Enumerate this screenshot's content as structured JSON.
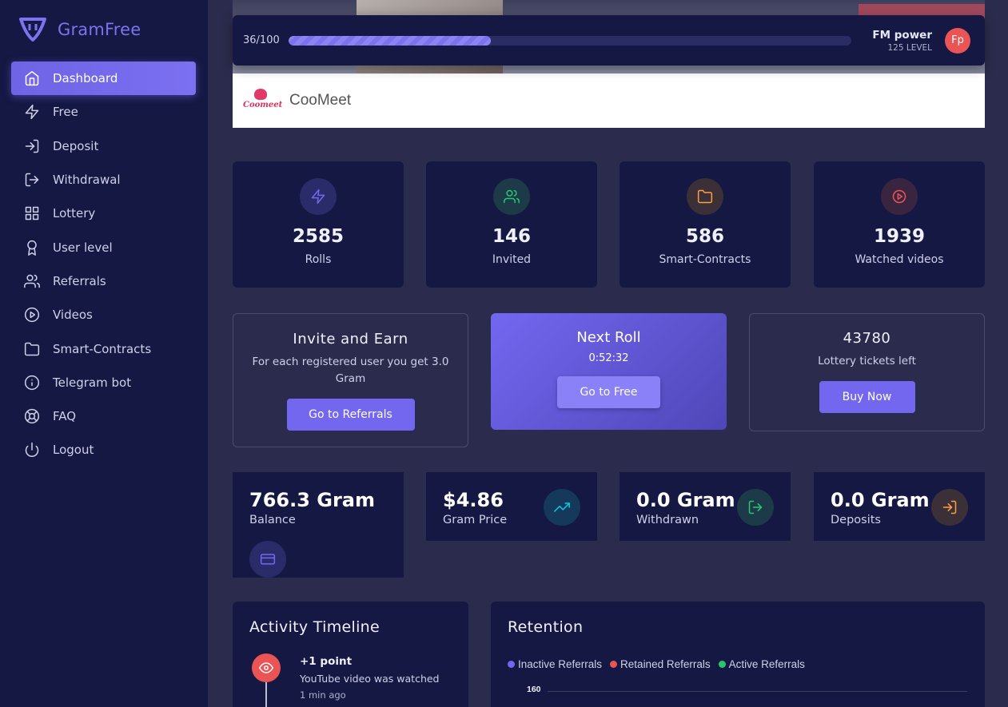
{
  "brand": {
    "name": "GramFree"
  },
  "sidebar": {
    "items": [
      {
        "label": "Dashboard",
        "icon": "home-icon",
        "active": true
      },
      {
        "label": "Free",
        "icon": "zap-icon"
      },
      {
        "label": "Deposit",
        "icon": "log-in-icon"
      },
      {
        "label": "Withdrawal",
        "icon": "log-out-icon"
      },
      {
        "label": "Lottery",
        "icon": "grid-icon"
      },
      {
        "label": "User level",
        "icon": "award-icon"
      },
      {
        "label": "Referrals",
        "icon": "users-icon"
      },
      {
        "label": "Videos",
        "icon": "play-circle-icon"
      },
      {
        "label": "Smart-Contracts",
        "icon": "folder-icon"
      },
      {
        "label": "Telegram bot",
        "icon": "info-icon"
      },
      {
        "label": "FAQ",
        "icon": "life-buoy-icon"
      },
      {
        "label": "Logout",
        "icon": "power-icon"
      }
    ]
  },
  "banner": {
    "brand": "CooMeet",
    "logo_text": "Coomeet"
  },
  "topbar": {
    "progress_label": "36/100",
    "progress_fraction": 0.36,
    "user_name": "FM power",
    "user_level": "125 LEVEL",
    "avatar_initials": "Fp"
  },
  "stats": [
    {
      "value": "2585",
      "label": "Rolls",
      "icon": "zap-icon",
      "color": "#7367f0"
    },
    {
      "value": "146",
      "label": "Invited",
      "icon": "users-icon",
      "color": "#28c76f"
    },
    {
      "value": "586",
      "label": "Smart-Contracts",
      "icon": "folder-icon",
      "color": "#ff9f43"
    },
    {
      "value": "1939",
      "label": "Watched videos",
      "icon": "play-circle-icon",
      "color": "#ea5455"
    }
  ],
  "invite": {
    "title": "Invite and Earn",
    "desc": "For each registered user you get 3.0 Gram",
    "button": "Go to Referrals"
  },
  "next_roll": {
    "title": "Next Roll",
    "timer": "0:52:32",
    "button": "Go to Free"
  },
  "lottery": {
    "count": "43780",
    "label": "Lottery tickets left",
    "button": "Buy Now"
  },
  "money": [
    {
      "amount": "766.3 Gram",
      "label": "Balance",
      "icon": "credit-card-icon",
      "color": "#7367f0"
    },
    {
      "amount": "$4.86",
      "label": "Gram Price",
      "icon": "trending-up-icon",
      "color": "#00cfe8"
    },
    {
      "amount": "0.0 Gram",
      "label": "Withdrawn",
      "icon": "log-out-icon",
      "color": "#28c76f"
    },
    {
      "amount": "0.0 Gram",
      "label": "Deposits",
      "icon": "log-in-icon",
      "color": "#ff9f43"
    }
  ],
  "activity": {
    "title": "Activity Timeline",
    "items": [
      {
        "title": "+1 point",
        "desc": "YouTube video was watched",
        "time": "1 min ago",
        "icon": "eye-icon"
      }
    ]
  },
  "retention": {
    "title": "Retention",
    "legend": [
      {
        "label": "Inactive Referrals",
        "color": "#7367f0"
      },
      {
        "label": "Retained Referrals",
        "color": "#ea5455"
      },
      {
        "label": "Active Referrals",
        "color": "#28c76f"
      }
    ],
    "ytick": "160"
  }
}
